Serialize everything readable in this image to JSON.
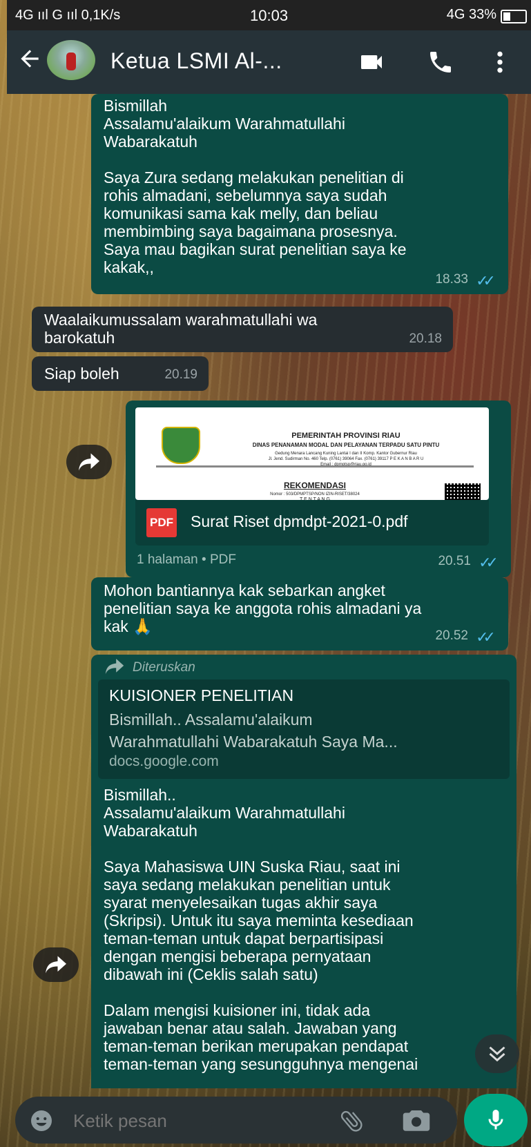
{
  "status_bar": {
    "left": "4G ııl G ııl 0,1K/s",
    "time": "10:03",
    "right": "4G 33%"
  },
  "header": {
    "title": "Ketua LSMI Al-..."
  },
  "messages": {
    "m1": {
      "text": "Bismillah\nAssalamu'alaikum Warahmatullahi\nWabarakatuh\n\nSaya Zura sedang melakukan penelitian di\nrohis almadani, sebelumnya saya sudah\nkomunikasi sama kak melly, dan beliau\nmembimbing saya bagaimana prosesnya.\nSaya mau bagikan surat penelitian saya ke\nkakak,,",
      "time": "18.33"
    },
    "m2": {
      "text": "Waalaikumussalam warahmatullahi wa\nbarokatuh",
      "time": "20.18"
    },
    "m3": {
      "text": "Siap boleh",
      "time": "20.19"
    },
    "m4": {
      "doc_header_1": "PEMERINTAH PROVINSI RIAU",
      "doc_header_2": "DINAS PENANAMAN MODAL DAN PELAYANAN TERPADU SATU PINTU",
      "doc_header_3": "Gedung Menara Lancang Kuning Lantai I dan II Komp. Kantor Gubernur Riau",
      "doc_header_4": "Jl. Jend. Sudirman No. 460 Telp. (0761) 39064 Fax. (0761) 39117 P E K A N B A R U",
      "doc_header_5": "Email : dpmptsp@riau.go.id",
      "doc_title": "REKOMENDASI",
      "doc_nomor": "Nomor : 503/DPMPTSP/NON IZIN-RISET/38024",
      "doc_tentang": "T E N T A N G",
      "pdf_label": "PDF",
      "filename": "Surat Riset dpmdpt-2021-0.pdf",
      "meta": "1 halaman • PDF",
      "time": "20.51"
    },
    "m5": {
      "text": "Mohon bantiannya kak sebarkan angket\npenelitian saya ke anggota rohis almadani ya\nkak 🙏",
      "time": "20.52"
    },
    "m6": {
      "forwarded": "Diteruskan",
      "link_title": "KUISIONER PENELITIAN",
      "link_desc": "Bismillah.. Assalamu'alaikum\nWarahmatullahi Wabarakatuh Saya Ma...",
      "link_domain": "docs.google.com",
      "text": "Bismillah..\nAssalamu'alaikum Warahmatullahi\nWabarakatuh\n\nSaya Mahasiswa UIN Suska Riau, saat ini\nsaya sedang melakukan penelitian untuk\nsyarat menyelesaikan tugas akhir saya\n(Skripsi). Untuk itu saya meminta kesediaan\nteman-teman untuk dapat berpartisipasi\ndengan mengisi beberapa pernyataan\ndibawah ini (Ceklis salah satu)\n\nDalam mengisi kuisioner ini, tidak ada\njawaban benar atau salah. Jawaban yang\nteman-teman berikan merupakan pendapat\nteman-teman yang sesungguhnya mengenai"
    }
  },
  "input": {
    "placeholder": "Ketik pesan"
  },
  "colors": {
    "outgoing_bubble": "#0b4b44",
    "incoming_bubble": "#262d31",
    "header": "#263238",
    "mic_button": "#00a884",
    "read_ticks": "#53bdeb"
  },
  "icons": [
    "back-arrow-icon",
    "video-call-icon",
    "phone-icon",
    "more-vert-icon",
    "forward-icon",
    "pdf-icon",
    "double-check-icon",
    "emoji-icon",
    "attach-icon",
    "camera-icon",
    "mic-icon",
    "scroll-down-icon"
  ]
}
